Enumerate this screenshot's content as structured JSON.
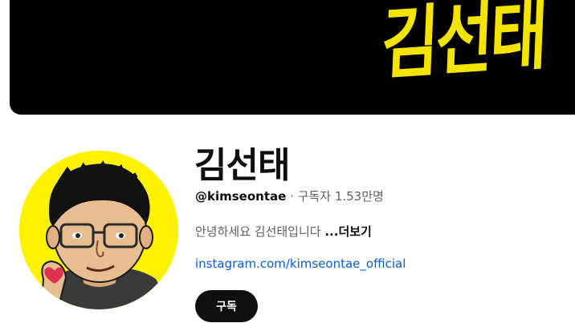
{
  "banner": {
    "logo_text": "김선태",
    "logo_color": "#f5e400",
    "background": "#000000"
  },
  "channel": {
    "name": "김선태",
    "handle": "@kimseontae",
    "separator": "·",
    "subscribers": "구독자 1.53만명",
    "description": "안녕하세요 김선태입니다",
    "more_label": "...더보기",
    "link": "instagram.com/kimseontae_official"
  },
  "actions": {
    "subscribe_label": "구독"
  },
  "colors": {
    "accent_link": "#065fd4",
    "avatar_bg": "#fff200",
    "button_bg": "#0f0f0f"
  }
}
